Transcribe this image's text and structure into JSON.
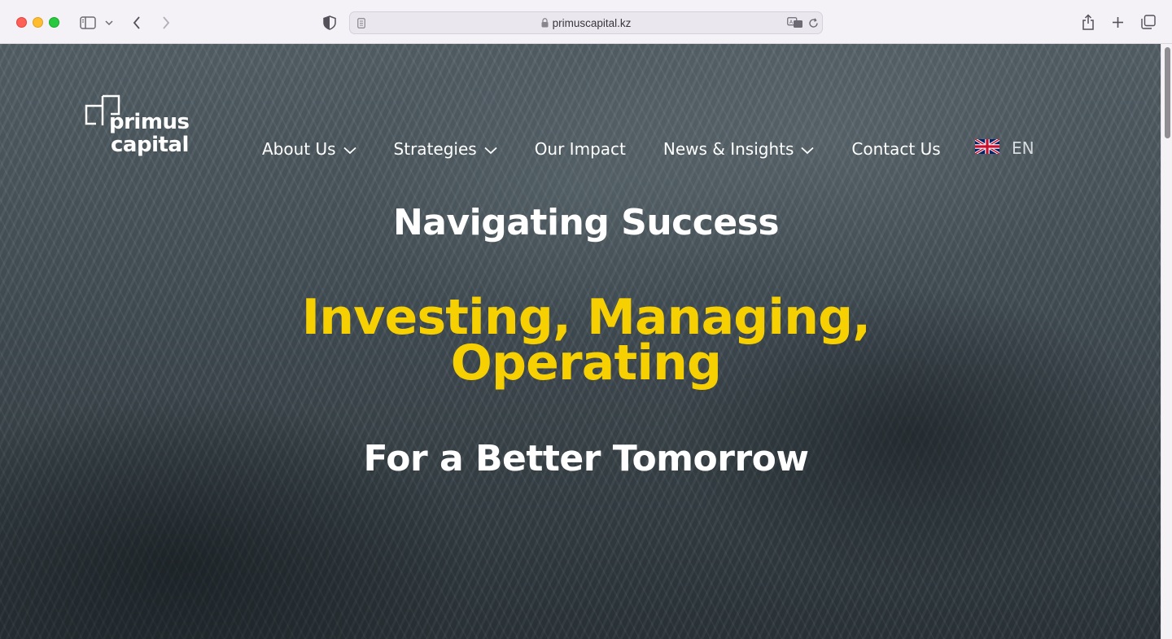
{
  "browser": {
    "url": "primuscapital.kz"
  },
  "logo": {
    "line1": "primus",
    "line2": "capital"
  },
  "nav": {
    "about": "About Us",
    "strategies": "Strategies",
    "impact": "Our Impact",
    "news": "News & Insights",
    "contact": "Contact Us"
  },
  "language": {
    "flag": "uk-flag-icon",
    "code": "EN"
  },
  "hero": {
    "heading": "Navigating Success",
    "tagline_line1": "Investing, Managing,",
    "tagline_line2": "Operating",
    "subheading": "For a Better Tomorrow"
  },
  "colors": {
    "accent": "#f6d001",
    "text": "#ffffff"
  }
}
